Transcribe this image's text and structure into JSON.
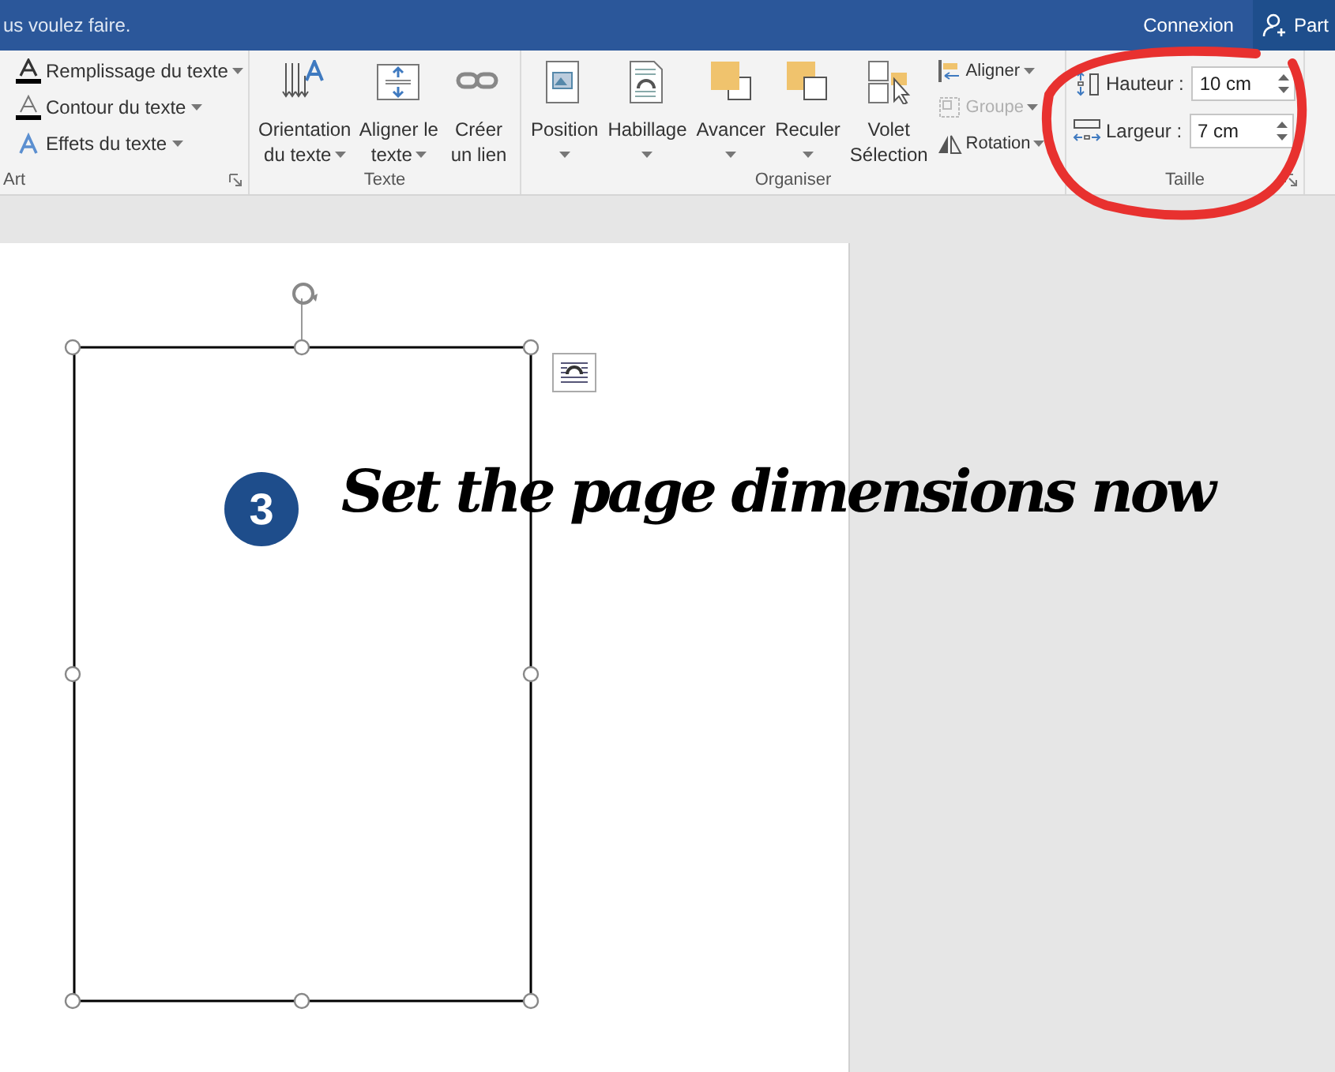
{
  "title_bar": {
    "search_hint": "us voulez faire.",
    "sign_in": "Connexion",
    "share": "Part"
  },
  "ribbon": {
    "groups": [
      {
        "kind": "list",
        "label": "Art",
        "items": [
          {
            "label": "Remplissage du texte",
            "dropdown": true
          },
          {
            "label": "Contour du texte",
            "dropdown": true
          },
          {
            "label": "Effets du texte",
            "dropdown": true
          }
        ]
      },
      {
        "kind": "big",
        "label": "Texte",
        "items": [
          {
            "lines": [
              "Orientation",
              "du texte"
            ],
            "dropdown": true
          },
          {
            "lines": [
              "Aligner le",
              "texte"
            ],
            "dropdown": true
          },
          {
            "lines": [
              "Créer",
              "un lien"
            ],
            "dropdown": false
          }
        ]
      },
      {
        "kind": "big",
        "label": "Organiser",
        "items": [
          {
            "lines": [
              "Position"
            ],
            "dropdown": true
          },
          {
            "lines": [
              "Habillage"
            ],
            "dropdown": true
          },
          {
            "lines": [
              "Avancer"
            ],
            "dropdown": true
          },
          {
            "lines": [
              "Reculer"
            ],
            "dropdown": true
          },
          {
            "lines": [
              "Volet",
              "Sélection"
            ],
            "dropdown": false
          }
        ],
        "small": [
          {
            "label": "Aligner",
            "disabled": false
          },
          {
            "label": "Groupe",
            "disabled": true
          },
          {
            "label": "Rotation",
            "disabled": false
          }
        ]
      },
      {
        "kind": "size",
        "label": "Taille",
        "fields": [
          {
            "label": "Hauteur :",
            "value": "10 cm"
          },
          {
            "label": "Largeur :",
            "value": "7 cm"
          }
        ]
      }
    ]
  },
  "annotation": {
    "step": "3",
    "text": "Set the page dimensions now"
  }
}
